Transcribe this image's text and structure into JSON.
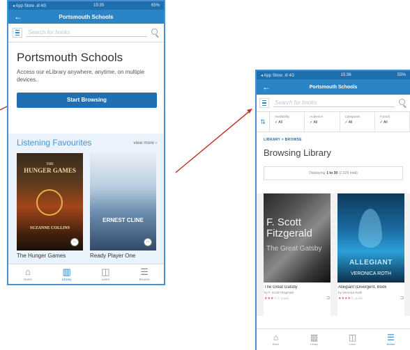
{
  "colors": {
    "brand": "#2b84c6",
    "status_bar": "#1e6fae",
    "start_button": "#1f6fb2",
    "favourites_bg": "#eaf3fb",
    "arrow": "#c0392b"
  },
  "phone1": {
    "status_left": "◂ App Store .ıll 4G",
    "status_time": "15:35",
    "status_battery": "65%",
    "title": "Portsmouth Schools",
    "search_placeholder": "Search for books",
    "library_title": "Portsmouth Schools",
    "library_desc": "Access our eLibrary anywhere, anytime, on multiple devices.",
    "start_button": "Start Browsing",
    "section_title": "Listening Favourites",
    "view_more": "view more ›",
    "books": [
      {
        "title": "The Hunger Games",
        "cover_top": "THE",
        "cover_main": "HUNGER GAMES",
        "cover_author": "SUZANNE COLLINS",
        "badge_icon": "headphones-icon"
      },
      {
        "title": "Ready Player One",
        "cover_main": "ERNEST CLINE",
        "badge_icon": "headphones-icon"
      }
    ],
    "nav": [
      {
        "label": "Home",
        "icon": "home-icon"
      },
      {
        "label": "Library",
        "icon": "library-icon",
        "active": true
      },
      {
        "label": "Learn",
        "icon": "book-icon"
      },
      {
        "label": "Browse",
        "icon": "list-icon"
      }
    ]
  },
  "phone2": {
    "status_left": "◂ App Store .ıll 4G",
    "status_time": "15:36",
    "status_battery": "55%",
    "title": "Portsmouth Schools",
    "search_placeholder": "Search for books",
    "filters": [
      {
        "label": "Availability",
        "value": "✓ All"
      },
      {
        "label": "Audience",
        "value": "✓ All"
      },
      {
        "label": "Categories",
        "value": "✓ All"
      },
      {
        "label": "Format",
        "value": "✓ All"
      }
    ],
    "breadcrumb": "LIBRARY  >  BROWSE",
    "browse_title": "Browsing Library",
    "displaying_prefix": "Displaying",
    "displaying_range": "1 to 30",
    "displaying_total": "(2,629 total)",
    "books": [
      {
        "title": "The Great Gatsby",
        "author": "by F. Scott Fitzgerald",
        "rating": "★★★☆☆",
        "rating_count": "(2,618)",
        "cover_main": "F. Scott Fitzgerald",
        "cover_sub": "The Great Gatsby"
      },
      {
        "title": "Allegiant (Divergent, Book",
        "author": "by Veronica Roth",
        "rating": "★★★★☆",
        "rating_count": "(4,116)",
        "cover_main": "ALLEGIANT",
        "cover_sub": "VERONICA ROTH"
      }
    ],
    "nav": [
      {
        "label": "Home",
        "icon": "home-icon"
      },
      {
        "label": "Library",
        "icon": "library-icon"
      },
      {
        "label": "Learn",
        "icon": "book-icon"
      },
      {
        "label": "Browse",
        "icon": "list-icon",
        "active": true
      }
    ]
  }
}
